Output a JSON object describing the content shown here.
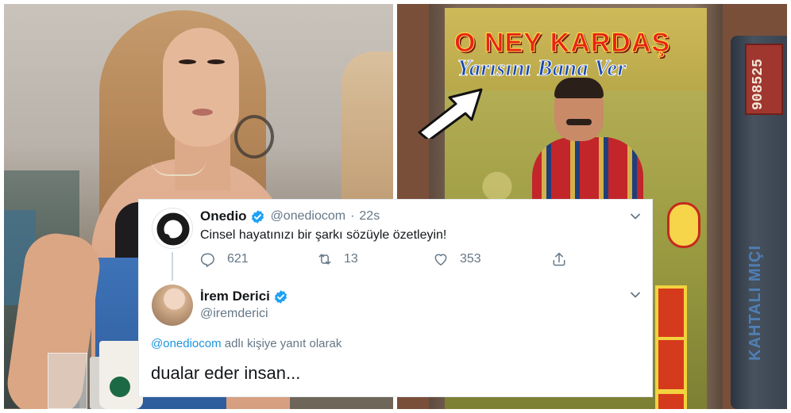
{
  "right_photo": {
    "cassette_title": "O NEY KARDAŞ",
    "cassette_subtitle": "Yarısını Bana Ver",
    "side_tape_number": "908525",
    "side_tape_spine": "KAHTALI MIÇI"
  },
  "tweet": {
    "author_name": "Onedio",
    "author_handle": "@onediocom",
    "time": "22s",
    "text": "Cinsel hayatınızı bir şarkı sözüyle özetleyin!",
    "reply_count": "621",
    "retweet_count": "13",
    "like_count": "353"
  },
  "reply": {
    "author_name": "İrem Derici",
    "author_handle": "@iremderici",
    "reply_to_handle": "@onediocom",
    "reply_to_suffix": " adlı kişiye yanıt olarak",
    "text": "dualar eder insan..."
  },
  "colors": {
    "verified_blue": "#1da1f2",
    "link_blue": "#1b95e0",
    "secondary_text": "#657786",
    "primary_text": "#14171a",
    "cassette_title_red": "#e8231a",
    "cassette_subtitle_blue": "#1a4ab0"
  },
  "icons": [
    "verified-badge-icon",
    "chevron-down-icon",
    "reply-icon",
    "retweet-icon",
    "like-heart-icon",
    "share-icon",
    "arrow-pointer-icon"
  ]
}
